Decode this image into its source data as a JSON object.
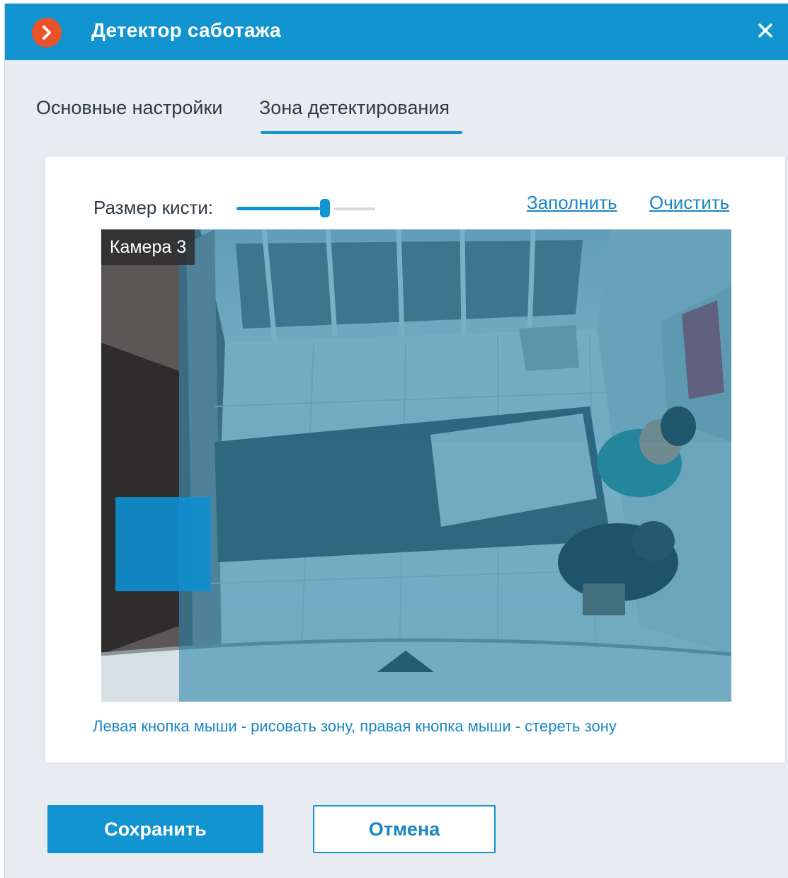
{
  "window": {
    "title": "Детектор саботажа",
    "accent_color": "#1194cf",
    "logo_icon": "chevron-right-icon",
    "close_icon": "close-icon"
  },
  "tabs": [
    {
      "label": "Основные настройки",
      "active": false
    },
    {
      "label": "Зона детектирования",
      "active": true
    }
  ],
  "zone_editor": {
    "brush_size_label": "Размер кисти:",
    "brush_size_fraction": 0.65,
    "fill_link": "Заполнить",
    "clear_link": "Очистить",
    "camera_label": "Камера 3",
    "hint": "Левая кнопка мыши - рисовать зону, правая кнопка мыши - стереть зону"
  },
  "buttons": {
    "save": "Сохранить",
    "cancel": "Отмена"
  }
}
